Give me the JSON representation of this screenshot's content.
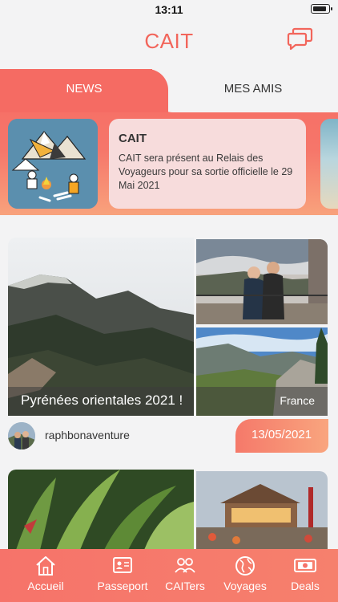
{
  "status_bar": {
    "time": "13:11"
  },
  "header": {
    "title": "CAIT"
  },
  "tabs": [
    {
      "label": "NEWS",
      "active": true
    },
    {
      "label": "MES AMIS",
      "active": false
    }
  ],
  "news": {
    "title": "CAIT",
    "text": "CAIT sera présent au Relais des Voyageurs pour sa sortie officielle le 29 Mai 2021"
  },
  "trip": {
    "title": "Pyrénées orientales 2021 !",
    "country": "France",
    "username": "raphbonaventure",
    "date": "13/05/2021"
  },
  "bottom_nav": [
    {
      "label": "Accueil",
      "icon": "home-icon",
      "active": true
    },
    {
      "label": "Passeport",
      "icon": "passport-icon"
    },
    {
      "label": "CAITers",
      "icon": "people-icon"
    },
    {
      "label": "Voyages",
      "icon": "globe-icon"
    },
    {
      "label": "Deals",
      "icon": "banknote-icon"
    }
  ],
  "colors": {
    "accent": "#f2655b",
    "gradient_end": "#f9a57e",
    "background": "#f3f3f4"
  }
}
